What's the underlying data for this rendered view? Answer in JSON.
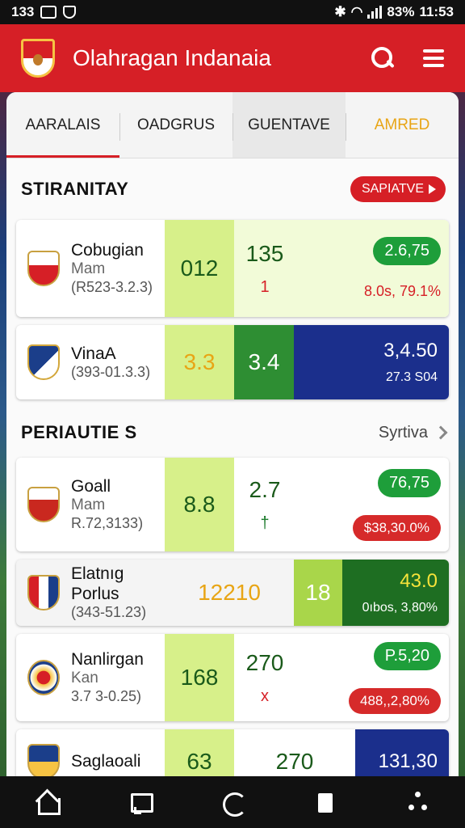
{
  "status": {
    "time_left": "133",
    "battery": "83%",
    "time_right": "11:53"
  },
  "app": {
    "title": "Olahragan Indanaia"
  },
  "tabs": [
    {
      "label": "AARALAIS"
    },
    {
      "label": "OADGRUS"
    },
    {
      "label": "GUENTAVE"
    },
    {
      "label": "AMRED"
    }
  ],
  "section1": {
    "title": "STIRANITAY",
    "pill_label": "SAPIATVE"
  },
  "section2": {
    "title": "PERIAUTIE S",
    "link_label": "Syrtiva"
  },
  "rows": [
    {
      "name": "Cobugian",
      "sub": "Mam",
      "odds": "(R523-3.2.3)",
      "v1": "012",
      "v2": "135",
      "note": "1",
      "badge": "2.6,75",
      "change": "8.0s, 79.1%"
    },
    {
      "name": "VinaA",
      "sub": "",
      "odds": "(393-01.3.3)",
      "v1": "3.3",
      "v2": "3.4",
      "note": "",
      "badge": "3,4.50",
      "change": "27.3 S04"
    },
    {
      "name": "Goall",
      "sub": "Mam",
      "odds": "R.72,3133)",
      "v1": "8.8",
      "v2": "2.7",
      "note": "†",
      "badge": "76,75",
      "change": "$38,30.0%"
    },
    {
      "name": "Elatnıg Porlus",
      "sub": "",
      "odds": "(343-51.23)",
      "v1": "12210",
      "v2": "18",
      "note": "",
      "badge": "43.0",
      "change": "0ıbos, 3,80%"
    },
    {
      "name": "Nanlirgan",
      "sub": "Kan",
      "odds": "3.7 3-0.25)",
      "v1": "168",
      "v2": "270",
      "note": "x",
      "badge": "P.5,20",
      "change": "488,,2,80%"
    },
    {
      "name": "Saglaoali",
      "sub": "",
      "odds": "",
      "v1": "63",
      "v2": "270",
      "note": "",
      "badge": "131,30",
      "change": ""
    }
  ]
}
